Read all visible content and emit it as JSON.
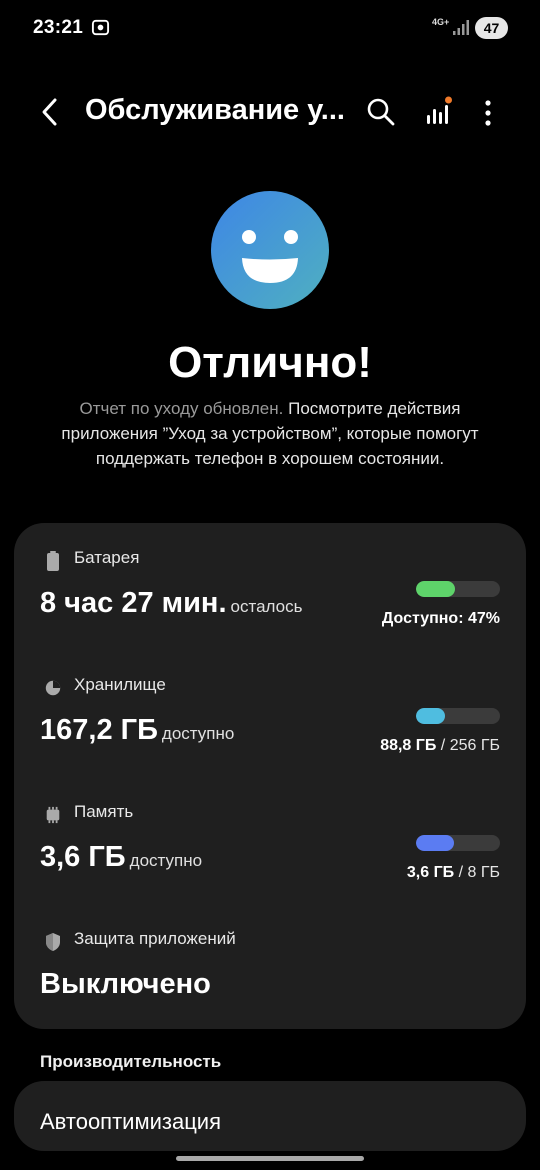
{
  "statusbar": {
    "time": "23:21",
    "network": "4G+",
    "battery": "47"
  },
  "appbar": {
    "title": "Обслуживание у..."
  },
  "hero": {
    "status": "Отлично!",
    "desc_grey": "Отчет по уходу обновлен.",
    "desc_rest": " Посмотрите действия приложения ”Уход за устройством”, которые помогут поддержать телефон в хорошем состоянии."
  },
  "battery": {
    "label": "Батарея",
    "value": "8 час 27 мин.",
    "suffix": "осталось",
    "bar_text": "Доступно: 47%",
    "fill": 0.47,
    "color": "#5ed36a"
  },
  "storage": {
    "label": "Хранилище",
    "value": "167,2 ГБ",
    "suffix": "доступно",
    "used": "88,8 ГБ",
    "total": "/ 256 ГБ",
    "fill": 0.35,
    "color": "#4fbde0"
  },
  "memory": {
    "label": "Память",
    "value": "3,6 ГБ",
    "suffix": "доступно",
    "used": "3,6 ГБ",
    "total": "/ 8 ГБ",
    "fill": 0.45,
    "color": "#5b7cf2"
  },
  "protection": {
    "label": "Защита приложений",
    "value": "Выключено"
  },
  "performance": {
    "header": "Производительность",
    "auto_label": "Автооптимизация"
  }
}
